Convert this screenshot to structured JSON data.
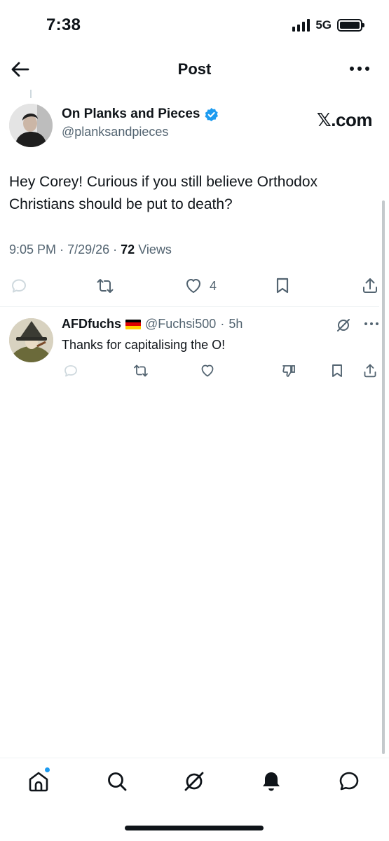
{
  "status_bar": {
    "time": "7:38",
    "network": "5G",
    "battery_level": 1.0
  },
  "nav": {
    "title": "Post"
  },
  "post": {
    "author_name": "On Planks and Pieces",
    "author_handle": "@planksandpieces",
    "verified": true,
    "brand": "𝕏.com",
    "text": "Hey Corey! Curious if you still believe Orthodox Christians should be put to death?",
    "time": "9:05 PM",
    "date": "7/29/26",
    "views_count": "72",
    "views_label": "Views",
    "likes_count": "4"
  },
  "reply": {
    "author_name": "AFDfuchs",
    "flag": "DE",
    "author_handle": "@Fuchsi500",
    "time_ago": "5h",
    "text": "Thanks for capitalising the O!"
  },
  "colors": {
    "accent": "#1d9bf0",
    "text_primary": "#0f1419",
    "text_secondary": "#536471",
    "divider": "#eff3f4"
  },
  "icons": {
    "top_left": "back-arrow-icon",
    "top_right": "more-icon",
    "actions": [
      "reply-icon",
      "retweet-icon",
      "like-icon",
      "bookmark-icon",
      "share-icon"
    ],
    "reply_actions": [
      "reply-icon",
      "retweet-icon",
      "like-icon",
      "downvote-icon",
      "bookmark-icon",
      "share-icon"
    ],
    "tabs": [
      "home-icon",
      "search-icon",
      "grok-icon",
      "notifications-icon",
      "messages-icon"
    ]
  }
}
